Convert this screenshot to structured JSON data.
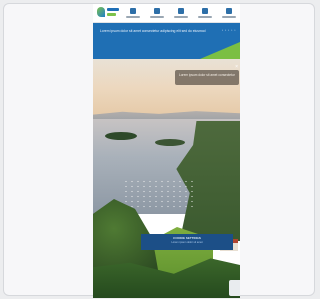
{
  "banner": {
    "text": "Lorem ipsum dolor sit amet consectetur adipiscing elit sed do eiusmod",
    "dots": "• • • • •"
  },
  "nav": {
    "items": [
      "",
      "",
      "",
      "",
      ""
    ]
  },
  "hero": {
    "info_text": "Lorem ipsum dolor sit amet consectetur"
  },
  "cookie": {
    "title": "COOKIE SETTINGS",
    "text": "Lorem ipsum dolor sit amet"
  },
  "colors": {
    "brand_blue": "#1f6fb4",
    "brand_green": "#7bbf43",
    "cookie_bg": "#1c4f87"
  },
  "icons": [
    "logo",
    "nav-icon",
    "close-icon"
  ]
}
